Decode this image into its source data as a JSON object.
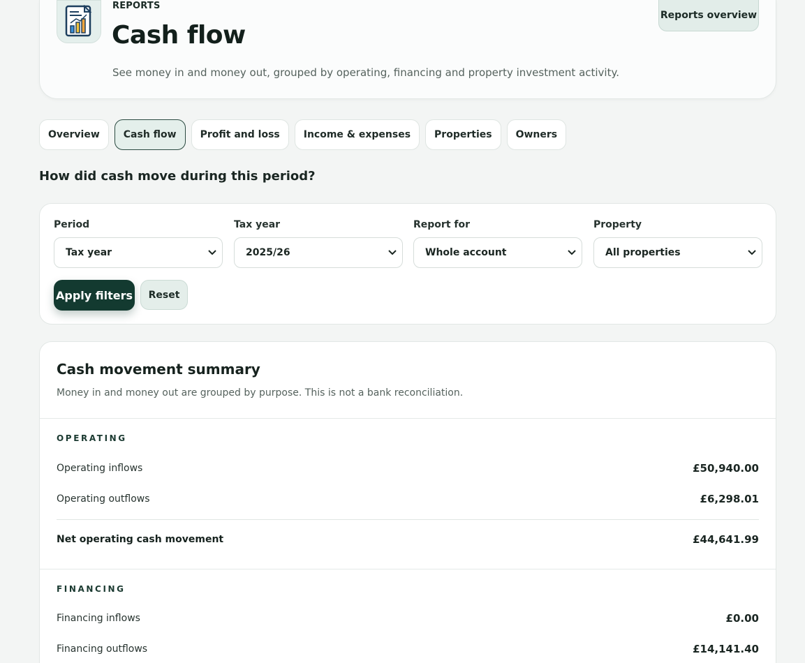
{
  "header": {
    "eyebrow": "REPORTS",
    "title": "Cash flow",
    "description": "See money in and money out, grouped by operating, financing and property investment activity.",
    "overview_button": "Reports overview",
    "icon": "report-chart-icon"
  },
  "tabs": [
    {
      "label": "Overview",
      "active": false
    },
    {
      "label": "Cash flow",
      "active": true
    },
    {
      "label": "Profit and loss",
      "active": false
    },
    {
      "label": "Income & expenses",
      "active": false
    },
    {
      "label": "Properties",
      "active": false
    },
    {
      "label": "Owners",
      "active": false
    }
  ],
  "question": "How did cash move during this period?",
  "filters": {
    "period": {
      "label": "Period",
      "value": "Tax year"
    },
    "tax_year": {
      "label": "Tax year",
      "value": "2025/26"
    },
    "report_for": {
      "label": "Report for",
      "value": "Whole account"
    },
    "property": {
      "label": "Property",
      "value": "All properties"
    },
    "apply_label": "Apply filters",
    "reset_label": "Reset"
  },
  "summary": {
    "title": "Cash movement summary",
    "subtitle": "Money in and money out are grouped by purpose. This is not a bank reconciliation.",
    "operating": {
      "heading": "OPERATING",
      "inflows_label": "Operating inflows",
      "inflows_value": "£50,940.00",
      "outflows_label": "Operating outflows",
      "outflows_value": "£6,298.01",
      "net_label": "Net operating cash movement",
      "net_value": "£44,641.99"
    },
    "financing": {
      "heading": "FINANCING",
      "inflows_label": "Financing inflows",
      "inflows_value": "£0.00",
      "outflows_label": "Financing outflows",
      "outflows_value": "£14,141.40"
    }
  },
  "colors": {
    "primary": "#133a30",
    "accent_bg": "#e4efeb",
    "background": "#f3f5f4"
  }
}
